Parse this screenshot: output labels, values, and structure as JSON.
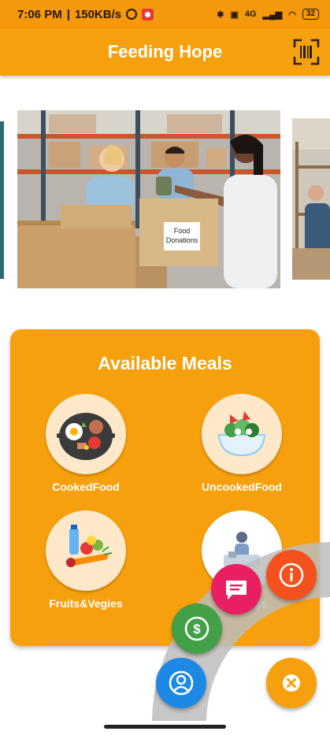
{
  "status_bar": {
    "time": "7:06 PM",
    "speed": "150KB/s",
    "network": "4G",
    "battery": "32"
  },
  "app_bar": {
    "title": "Feeding Hope"
  },
  "carousel": {
    "banner_text": "Food Donations"
  },
  "meals_card": {
    "title": "Available Meals",
    "items": [
      {
        "label": "CookedFood"
      },
      {
        "label": "UncookedFood"
      },
      {
        "label": "Fruits&Vegies"
      },
      {
        "label": "Clothings"
      }
    ]
  },
  "fab_menu": {
    "items": [
      "info-icon",
      "chat-icon",
      "dollar-icon",
      "profile-icon",
      "close-icon"
    ]
  },
  "colors": {
    "primary": "#f7a00d",
    "info": "#f4511e",
    "chat": "#e91e63",
    "donate": "#43a047",
    "profile": "#1e88e5",
    "arc": "#bdbdbd"
  }
}
